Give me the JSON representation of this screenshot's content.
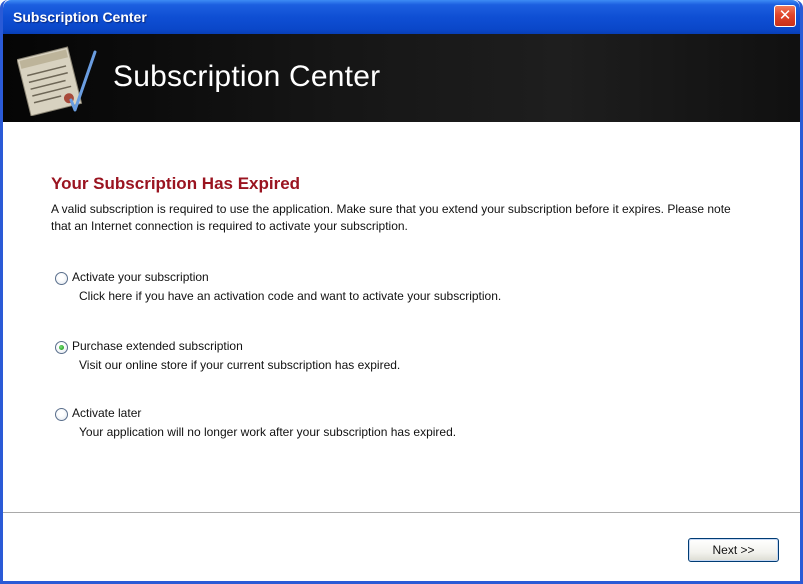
{
  "window": {
    "title": "Subscription Center",
    "close_glyph": "✕"
  },
  "banner": {
    "title": "Subscription Center",
    "icon": "document-check-icon"
  },
  "content": {
    "heading": "Your Subscription Has Expired",
    "intro": "A valid subscription is required to use the application. Make sure that you extend your subscription before it expires. Please note that an Internet connection is required to activate your subscription.",
    "options": [
      {
        "label": "Activate your subscription",
        "description": "Click here if you have an activation code and want to activate your subscription.",
        "selected": false
      },
      {
        "label": "Purchase extended subscription",
        "description": "Visit our online store if your current subscription has expired.",
        "selected": true
      },
      {
        "label": "Activate later",
        "description": "Your application will no longer work after your subscription has expired.",
        "selected": false
      }
    ]
  },
  "footer": {
    "next_label": "Next >>"
  },
  "colors": {
    "titlebar": "#0f4fd4",
    "heading": "#9a1420",
    "banner": "#111111",
    "radio_selected": "#2aa62a"
  }
}
